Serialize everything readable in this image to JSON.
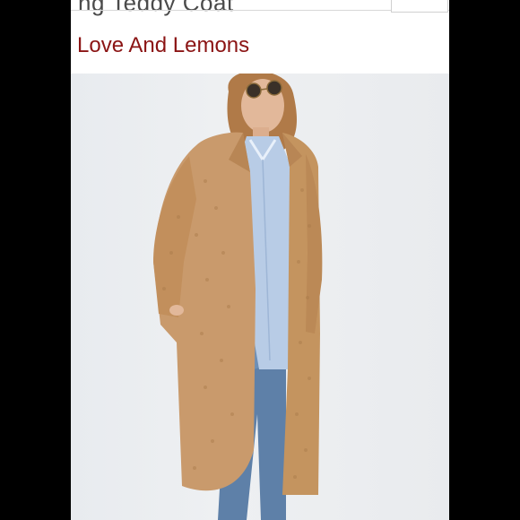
{
  "listing": {
    "title_partial": "ng Teddy Coat",
    "brand": "Love And Lemons"
  },
  "photo": {
    "subject": "teddy-coat-model-photo",
    "coat_color": "#c99a6c",
    "background_color": "#eceef1"
  }
}
